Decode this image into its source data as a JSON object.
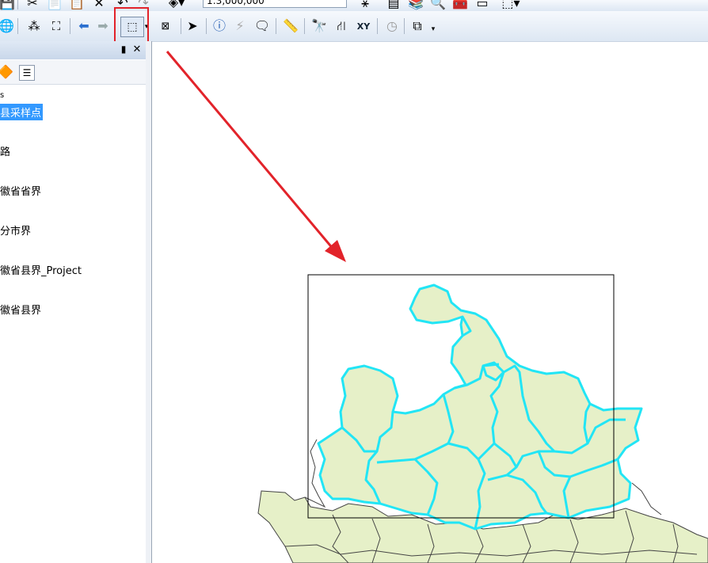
{
  "toolbar_top": {
    "scale_value": "1:3,000,000",
    "icons": [
      "save-icon",
      "cut-icon",
      "copy-icon",
      "paste-icon",
      "delete-icon",
      "undo-icon",
      "redo-icon",
      "add-data-icon",
      "editor-icon",
      "table-icon",
      "catalog-icon",
      "search-icon",
      "toolbox-icon",
      "python-icon",
      "model-icon"
    ]
  },
  "toolbar_map": {
    "icons": [
      "globe-icon",
      "fixed-zoom-in-icon",
      "fixed-zoom-out-icon",
      "back-icon",
      "forward-icon",
      "select-by-rectangle-icon",
      "clear-selection-icon",
      "select-elements-icon",
      "identify-icon",
      "hyperlink-icon",
      "html-popup-icon",
      "measure-icon",
      "find-icon",
      "find-route-icon",
      "go-to-xy-icon",
      "time-slider-icon",
      "create-viewer-icon"
    ]
  },
  "toc": {
    "layers": [
      {
        "label": "县采样点",
        "selected": true
      },
      {
        "label": "路",
        "selected": false
      },
      {
        "label": "徽省省界",
        "selected": false
      },
      {
        "label": "分市界",
        "selected": false
      },
      {
        "label": "徽省县界_Project",
        "selected": false
      },
      {
        "label": "徽省县界",
        "selected": false
      }
    ]
  },
  "colors": {
    "highlight_box": "#e2232a",
    "arrow": "#e2232a",
    "selected_outline": "#22e5f5",
    "polygon_fill": "#e6f0c8",
    "selection_bg": "#3399ff"
  }
}
